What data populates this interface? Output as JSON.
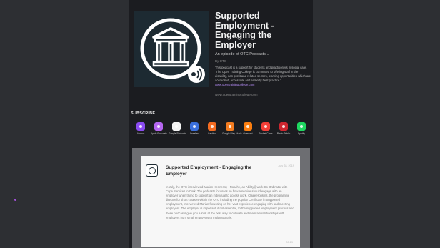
{
  "podcast": {
    "title": "Supported Employment - Engaging the Employer",
    "subtitle": "An episode of OTC Podcasts...",
    "byline": "By OTC",
    "description": "This podcast is a support for students and practitioners in social care.",
    "quote": "\"The Open Training College is committed to offering staff in the disability, non-profit and related sectors, learning opportunities which are accredited, accessible and embody best practice.\"",
    "quote_link": "www.opentrainingcollege.com",
    "website": "www.opentrainingcollege.com"
  },
  "subscribe": {
    "label": "SUBSCRIBE",
    "services": [
      {
        "label": "Anchor",
        "color": "#8a4bf0",
        "icon": "anchor-icon"
      },
      {
        "label": "Apple Podcasts",
        "color": "#b566f0",
        "icon": "apple-podcasts-icon"
      },
      {
        "label": "Google Podcasts",
        "color": "#f3f3f3",
        "icon": "google-podcasts-icon"
      },
      {
        "label": "Breaker",
        "color": "#3a6fdc",
        "icon": "breaker-icon"
      },
      {
        "label": "Castbox",
        "color": "#f36b21",
        "icon": "castbox-icon"
      },
      {
        "label": "Google Play Music",
        "color": "#f47c20",
        "icon": "google-play-music-icon"
      },
      {
        "label": "Overcast",
        "color": "#fc7e0f",
        "icon": "overcast-icon"
      },
      {
        "label": "Pocket Casts",
        "color": "#f43e37",
        "icon": "pocket-casts-icon"
      },
      {
        "label": "Radio Public",
        "color": "#ce262f",
        "icon": "radiopublic-icon"
      },
      {
        "label": "Spotify",
        "color": "#1ed760",
        "icon": "spotify-icon"
      }
    ]
  },
  "episode": {
    "title": "Supported Employment - Engaging the Employer",
    "date": "July 28, 2019",
    "duration": "00:19",
    "text": "In July, the OTC interviewed Marian Hennessy - Roache, an Ability@work Co-Ordinator with Cope Services in Cork. The podcasts focusses on how a service should engage with an employer when trying to support an individual to access work. Claire Hopkins, the programme director for short courses within the OTC including the popular Certificate in Supported employment, interviewed Marian focussing on her vast experience engaging with and meeting employers. The employer is important, if not essential, to the supported employment process and these podcasts give you a look at the best way to cultivate and maintain relationships with employers from small employers to multinationals."
  }
}
